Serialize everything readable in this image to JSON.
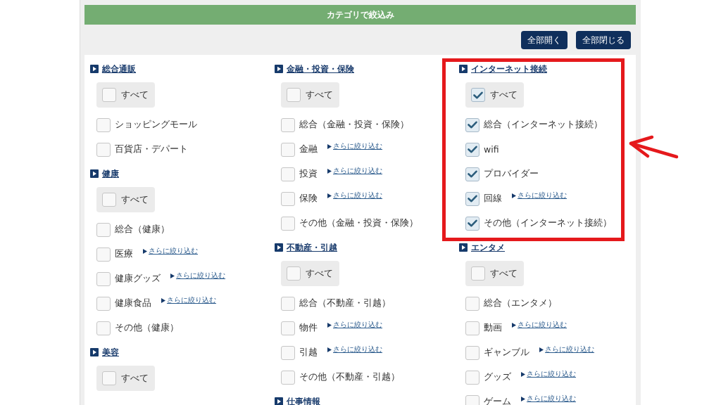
{
  "panel": {
    "title": "カテゴリで絞込み"
  },
  "toolbar": {
    "buttons": [
      "全部開く",
      "全部閉じる"
    ]
  },
  "columns": [
    {
      "sections": [
        {
          "title": "総合通販",
          "highlighted": false,
          "all": {
            "label": "すべて",
            "checked": false
          },
          "items": [
            {
              "label": "ショッピングモール",
              "checked": false
            },
            {
              "label": "百貨店・デパート",
              "checked": false
            }
          ]
        },
        {
          "title": "健康",
          "highlighted": false,
          "all": {
            "label": "すべて",
            "checked": false
          },
          "items": [
            {
              "label": "総合（健康）",
              "checked": false
            },
            {
              "label": "医療",
              "checked": false,
              "link": "さらに絞り込む"
            },
            {
              "label": "健康グッズ",
              "checked": false,
              "link": "さらに絞り込む"
            },
            {
              "label": "健康食品",
              "checked": false,
              "link": "さらに絞り込む"
            },
            {
              "label": "その他（健康）",
              "checked": false
            }
          ]
        },
        {
          "title": "美容",
          "highlighted": false,
          "all": {
            "label": "すべて",
            "checked": false
          }
        }
      ]
    },
    {
      "sections": [
        {
          "title": "金融・投資・保険",
          "highlighted": false,
          "all": {
            "label": "すべて",
            "checked": false
          },
          "items": [
            {
              "label": "総合（金融・投資・保険）",
              "checked": false
            },
            {
              "label": "金融",
              "checked": false,
              "link": "さらに絞り込む"
            },
            {
              "label": "投資",
              "checked": false,
              "link": "さらに絞り込む"
            },
            {
              "label": "保険",
              "checked": false,
              "link": "さらに絞り込む"
            },
            {
              "label": "その他（金融・投資・保険）",
              "checked": false
            }
          ]
        },
        {
          "title": "不動産・引越",
          "highlighted": false,
          "all": {
            "label": "すべて",
            "checked": false
          },
          "items": [
            {
              "label": "総合（不動産・引越）",
              "checked": false
            },
            {
              "label": "物件",
              "checked": false,
              "link": "さらに絞り込む"
            },
            {
              "label": "引越",
              "checked": false,
              "link": "さらに絞り込む"
            },
            {
              "label": "その他（不動産・引越）",
              "checked": false
            }
          ]
        },
        {
          "title": "仕事情報",
          "highlighted": false
        }
      ]
    },
    {
      "sections": [
        {
          "title": "インターネット接続",
          "highlighted": true,
          "all": {
            "label": "すべて",
            "checked": true
          },
          "items": [
            {
              "label": "総合（インターネット接続）",
              "checked": true
            },
            {
              "label": "wifi",
              "checked": true
            },
            {
              "label": "プロバイダー",
              "checked": true
            },
            {
              "label": "回線",
              "checked": true,
              "link": "さらに絞り込む"
            },
            {
              "label": "その他（インターネット接続）",
              "checked": true
            }
          ]
        },
        {
          "title": "エンタメ",
          "highlighted": false,
          "all": {
            "label": "すべて",
            "checked": false
          },
          "items": [
            {
              "label": "総合（エンタメ）",
              "checked": false
            },
            {
              "label": "動画",
              "checked": false,
              "link": "さらに絞り込む"
            },
            {
              "label": "ギャンブル",
              "checked": false,
              "link": "さらに絞り込む"
            },
            {
              "label": "グッズ",
              "checked": false,
              "link": "さらに絞り込む"
            },
            {
              "label": "ゲーム",
              "checked": false,
              "link": "さらに絞り込む"
            }
          ]
        }
      ]
    }
  ]
}
